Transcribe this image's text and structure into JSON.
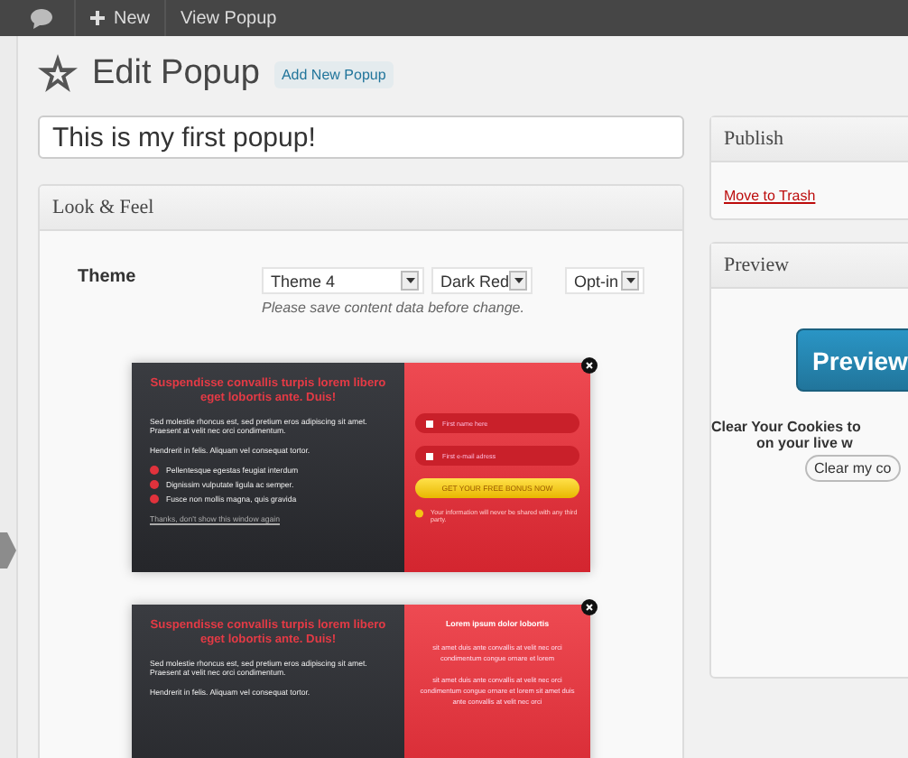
{
  "admin_bar": {
    "new_label": "New",
    "view_label": "View Popup"
  },
  "page": {
    "title": "Edit Popup",
    "add_new": "Add New Popup"
  },
  "title_field": {
    "value": "This is my first popup!"
  },
  "look_feel": {
    "heading": "Look & Feel",
    "theme_label": "Theme",
    "selects": [
      "Theme 4",
      "Dark Red",
      "Opt-in"
    ],
    "hint": "Please save content data before change.",
    "themes": [
      {
        "kind": "optin",
        "title": "Suspendisse convallis turpis lorem libero eget lobortis ante. Duis!",
        "paragraph": "Sed molestie rhoncus est, sed pretium eros adipiscing sit amet. Praesent at velit nec orci condimentum.",
        "note": "Hendrerit in felis. Aliquam vel consequat tortor.",
        "bullets": [
          "Pellentesque egestas feugiat interdum",
          "Dignissim vulputate ligula ac semper.",
          "Fusce non mollis magna, quis gravida"
        ],
        "footer_link": "Thanks, don't show this window again",
        "fields": [
          "First name here",
          "First e-mail adress"
        ],
        "button": "GET YOUR FREE BONUS NOW",
        "privacy": "Your information will never be shared with any third party."
      },
      {
        "kind": "text",
        "title": "Suspendisse convallis turpis lorem libero eget lobortis ante. Duis!",
        "paragraph": "Sed molestie rhoncus est, sed pretium eros adipiscing sit amet. Praesent at velit nec orci condimentum.",
        "note": "Hendrerit in felis. Aliquam vel consequat tortor.",
        "right_title": "Lorem ipsum dolor lobortis",
        "right_paragraphs": [
          "sit amet duis ante convallis at velit nec orci condimentum congue ornare et lorem",
          "sit amet duis ante convallis at velit nec orci condimentum congue ornare et lorem sit amet duis ante convallis at velit nec orci"
        ]
      }
    ]
  },
  "publish": {
    "heading": "Publish",
    "trash": "Move to Trash"
  },
  "preview": {
    "heading": "Preview",
    "button": "Preview",
    "notice": [
      "Clear Your Cookies to",
      "on your live w"
    ],
    "clear_button": "Clear my co"
  }
}
